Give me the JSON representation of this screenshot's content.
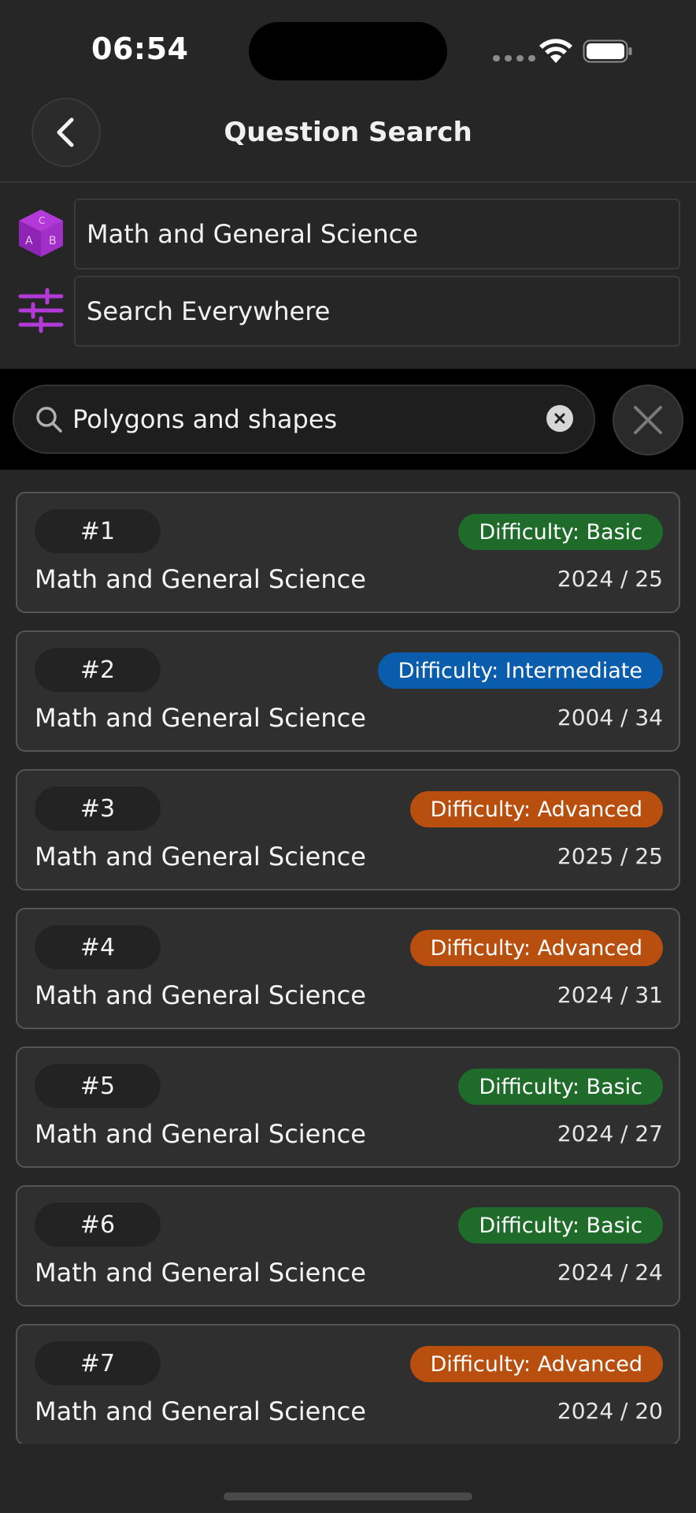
{
  "status_bar": {
    "time": "06:54"
  },
  "header": {
    "title": "Question Search"
  },
  "filters": {
    "subject": "Math and General Science",
    "scope": "Search Everywhere"
  },
  "search": {
    "query": "Polygons and shapes"
  },
  "icons": {
    "back": "chevron-left-icon",
    "subject": "cube-abc-icon",
    "scope": "sliders-icon",
    "search": "search-icon",
    "clear": "clear-x-icon",
    "close": "close-icon"
  },
  "colors": {
    "accent": "#9b2fbf",
    "basic": "#1e6b2a",
    "intermediate": "#0a5cad",
    "advanced": "#b94f0e"
  },
  "results": [
    {
      "number": "#1",
      "difficulty": "Difficulty: Basic",
      "level": "basic",
      "subject": "Math and General Science",
      "year": "2024 / 25"
    },
    {
      "number": "#2",
      "difficulty": "Difficulty: Intermediate",
      "level": "intermediate",
      "subject": "Math and General Science",
      "year": "2004 / 34"
    },
    {
      "number": "#3",
      "difficulty": "Difficulty: Advanced",
      "level": "advanced",
      "subject": "Math and General Science",
      "year": "2025 / 25"
    },
    {
      "number": "#4",
      "difficulty": "Difficulty: Advanced",
      "level": "advanced",
      "subject": "Math and General Science",
      "year": "2024 / 31"
    },
    {
      "number": "#5",
      "difficulty": "Difficulty: Basic",
      "level": "basic",
      "subject": "Math and General Science",
      "year": "2024 / 27"
    },
    {
      "number": "#6",
      "difficulty": "Difficulty: Basic",
      "level": "basic",
      "subject": "Math and General Science",
      "year": "2024 / 24"
    },
    {
      "number": "#7",
      "difficulty": "Difficulty: Advanced",
      "level": "advanced",
      "subject": "Math and General Science",
      "year": "2024 / 20"
    }
  ]
}
